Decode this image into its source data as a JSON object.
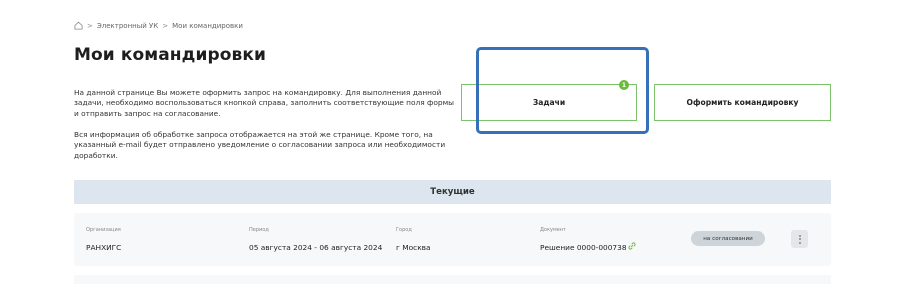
{
  "breadcrumb": {
    "items": [
      "Электронный УК",
      "Мои командировки"
    ],
    "separator": ">"
  },
  "page": {
    "title": "Мои командировки",
    "description_1": "На данной странице Вы можете оформить запрос на командировку. Для выполнения данной задачи, необходимо воспользоваться кнопкой справа, заполнить соответствующие поля формы и отправить запрос на согласование.",
    "description_2": "Вся информация об обработке запроса отображается на этой же странице. Кроме того, на указанный e-mail будет отправлено уведомление о согласовании запроса или необходимости доработки."
  },
  "actions": {
    "tasks_label": "Задачи",
    "tasks_badge": "1",
    "create_trip_label": "Оформить командировку"
  },
  "section": {
    "current_label": "Текущие"
  },
  "trips": [
    {
      "org_label": "Организация",
      "org": "РАНХИГС",
      "period_label": "Период",
      "period": "05 августа 2024 - 06 августа 2024",
      "city_label": "Город",
      "city": "г Москва",
      "doc_label": "Документ",
      "doc": "Решение 0000-000738",
      "status": "на согласовании"
    }
  ],
  "colors": {
    "accent_green": "#7cc36b",
    "badge_green": "#6cbb3c",
    "highlight_blue": "#3570b8",
    "section_bg": "#dde6ef"
  },
  "icons": {
    "home": "home-icon",
    "link": "link-icon",
    "menu": "more-vertical-icon"
  }
}
